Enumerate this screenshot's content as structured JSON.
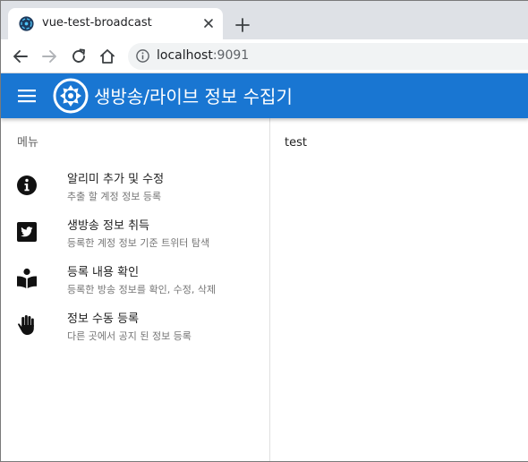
{
  "browser": {
    "tab": {
      "title": "vue-test-broadcast"
    },
    "url": {
      "host": "localhost",
      "port": ":9091"
    }
  },
  "app": {
    "title": "생방송/라이브 정보 수집기"
  },
  "sidebar": {
    "header": "메뉴",
    "items": [
      {
        "title": "알리미 추가 및 수정",
        "subtitle": "추출 할 계정 정보 등록",
        "icon": "info-circle-icon"
      },
      {
        "title": "생방송 정보 취득",
        "subtitle": "등록한 계정 정보 기준 트위터 탐색",
        "icon": "twitter-icon"
      },
      {
        "title": "등록 내용 확인",
        "subtitle": "등록한 방송 정보를 확인, 수정, 삭제",
        "icon": "book-reader-icon"
      },
      {
        "title": "정보 수동 등록",
        "subtitle": "다른 곳에서 공지 된 정보 등록",
        "icon": "hand-icon"
      }
    ]
  },
  "content": {
    "text": "test"
  },
  "colors": {
    "appbar": "#1976d2",
    "tabstrip": "#dee1e6",
    "omnibox": "#f1f3f4"
  }
}
